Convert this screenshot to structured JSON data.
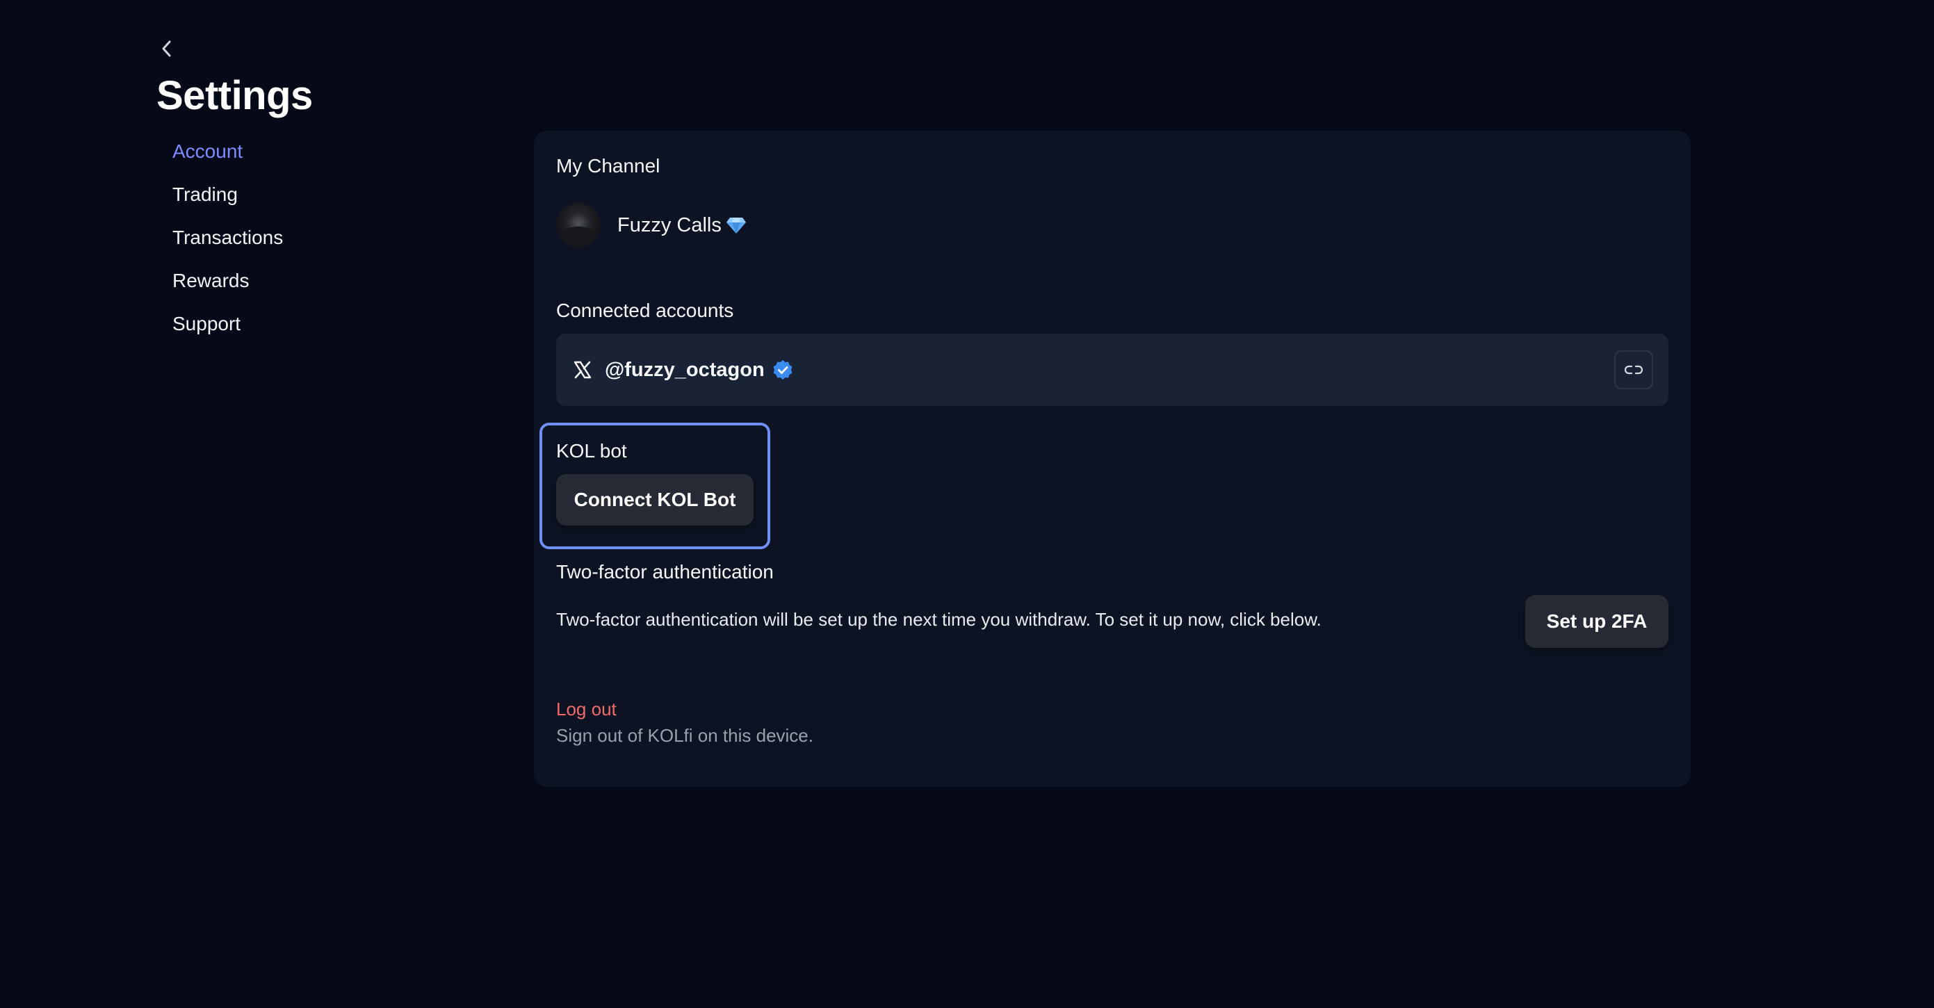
{
  "header": {
    "back_icon": "chevron-left-icon",
    "title": "Settings"
  },
  "sidebar": {
    "items": [
      {
        "label": "Account",
        "active": true
      },
      {
        "label": "Trading",
        "active": false
      },
      {
        "label": "Transactions",
        "active": false
      },
      {
        "label": "Rewards",
        "active": false
      },
      {
        "label": "Support",
        "active": false
      }
    ],
    "active_color": "#7b8cff"
  },
  "my_channel": {
    "title": "My Channel",
    "name": "Fuzzy Calls",
    "badge_icon": "diamond-icon"
  },
  "connected_accounts": {
    "title": "Connected accounts",
    "accounts": [
      {
        "platform_icon": "x-logo-icon",
        "handle": "@fuzzy_octagon",
        "verified": true,
        "action_icon": "unlink-icon"
      }
    ]
  },
  "kol_bot": {
    "title": "KOL bot",
    "button_label": "Connect KOL Bot",
    "highlight_color": "#6f8ff5"
  },
  "two_factor": {
    "title": "Two-factor authentication",
    "description": "Two-factor authentication will be set up the next time you withdraw. To set it up now, click below.",
    "button_label": "Set up 2FA"
  },
  "logout": {
    "label": "Log out",
    "description": "Sign out of KOLfi on this device.",
    "color": "#f06b6b"
  }
}
